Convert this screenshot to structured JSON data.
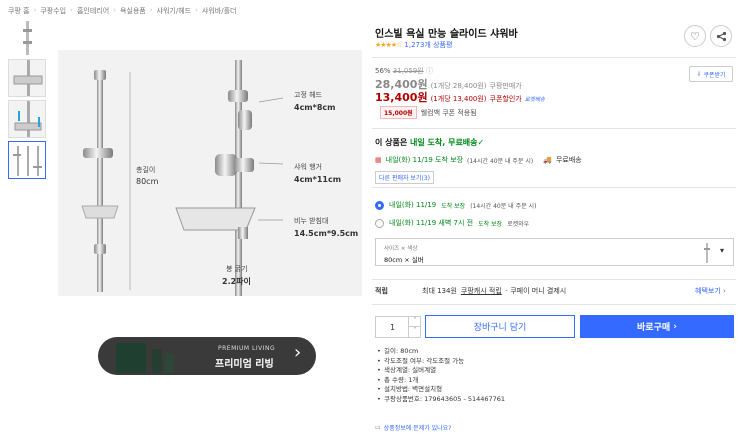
{
  "breadcrumb": [
    "쿠팡 홈",
    "쿠팡수입",
    "홈인테리어",
    "욕실용품",
    "샤워기/헤드",
    "샤워바/홀더"
  ],
  "image": {
    "labels": {
      "head": "고정 헤드",
      "head_size": "4cm*8cm",
      "hanger": "샤워 행거",
      "hanger_size": "4cm*11cm",
      "tray": "비누 받침대",
      "tray_size": "14.5cm*9.5cm",
      "length": "총길이",
      "length_value": "80cm",
      "thickness": "봉 굵기",
      "thickness_value": "2.2파이"
    }
  },
  "banner": {
    "top": "PREMIUM LIVING",
    "bottom": "프리미엄 리빙",
    "arrow": "chevron-right-icon"
  },
  "product": {
    "title": "인스빌 욕실 만능 슬라이드 샤워바",
    "review_count": "1,273개 상품평",
    "discount_rate": "56%",
    "original_price": "31,059원",
    "price": "28,400원",
    "price_unit": "(1개당 28,400원)",
    "price_note": "쿠팡판매가",
    "coupon_price": "13,400원",
    "coupon_unit": "(1개당 13,400원)",
    "coupon_note": "쿠폰할인가",
    "coupon_badge": "로켓배송",
    "coupon_button": "쿠폰받기",
    "wow_amount": "15,000원",
    "wow_text": "웰컴백 쿠폰 적용됨"
  },
  "delivery": {
    "headline_prefix": "이 상품은",
    "headline_highlight": "내일 도착, 무료배송",
    "line1_date": "내일(화) 11/19 도착 보장",
    "line1_note": "(14시간 40분 내 주문 시)",
    "free": "무료배송",
    "other_sellers": "다른 판매자 보기(3)",
    "option1_date": "내일(화) 11/19",
    "option1_tag": "도착 보장",
    "option1_note": "(14시간 40분 내 주문 시)",
    "option2_date": "내일(화) 11/19 새벽 7시 전",
    "option2_tag": "도착 보장",
    "option2_note": "로켓와우"
  },
  "option_select": {
    "label": "사이즈 × 색상",
    "value": "80cm × 실버"
  },
  "cashback": {
    "label": "적립",
    "text": "최대 134원",
    "link": "쿠팡캐시 적립",
    "note": "· 쿠페이 머니 결제시",
    "benefit": "혜택보기"
  },
  "purchase": {
    "qty": "1",
    "cart": "장바구니 담기",
    "buy": "바로구매"
  },
  "details": [
    "길이: 80cm",
    "각도조절 여부: 각도조절 가능",
    "색상계열: 실버계열",
    "총 수량: 1개",
    "설치방법: 벽면설치형",
    "쿠팡상품번호: 179643605 - 514467761"
  ],
  "report": "상품정보에 문제가 있나요?"
}
